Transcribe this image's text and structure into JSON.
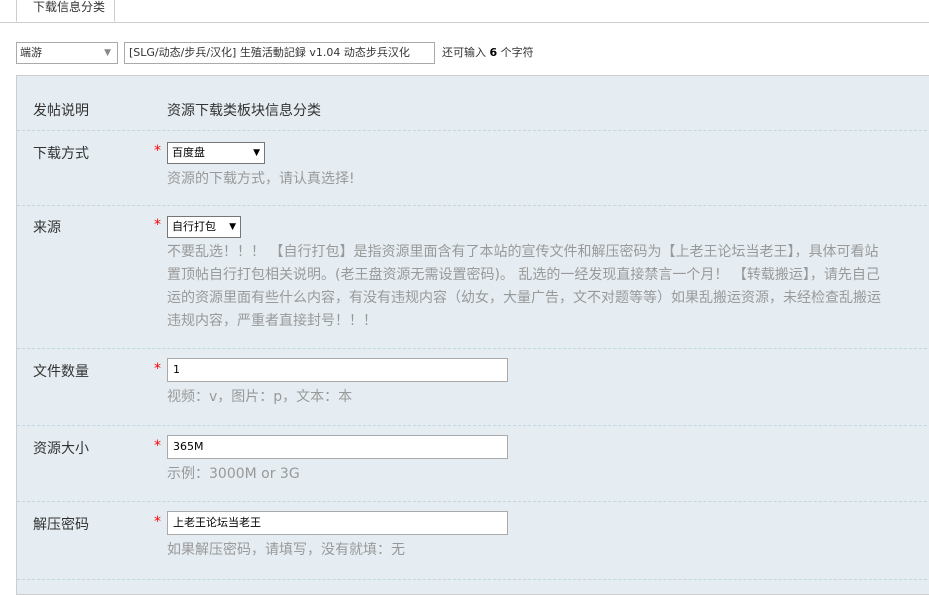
{
  "tab": {
    "label": "下载信息分类"
  },
  "title_row": {
    "type_select": "端游",
    "title_value": "[SLG/动态/步兵/汉化] 生殖活動記録 v1.04 动态步兵汉化",
    "remaining_prefix": "还可输入",
    "remaining_count": "6",
    "remaining_suffix": "个字符"
  },
  "form": {
    "intro": {
      "label": "发帖说明",
      "value": "资源下载类板块信息分类"
    },
    "download_method": {
      "label": "下载方式",
      "required": "*",
      "selected": "百度盘",
      "hint": "资源的下载方式，请认真选择!"
    },
    "source": {
      "label": "来源",
      "required": "*",
      "selected": "自行打包",
      "hint_lines": [
        "不要乱选！！！ 【自行打包】是指资源里面含有了本站的宣传文件和解压密码为【上老王论坛当老王】，具体可看站",
        "置顶帖自行打包相关说明。(老王盘资源无需设置密码)。 乱选的一经发现直接禁言一个月！ 【转载搬运】，请先自己",
        "运的资源里面有些什么内容，有没有违规内容（幼女，大量广告，文不对题等等）如果乱搬运资源，未经检查乱搬运",
        "违规内容，严重者直接封号！！！"
      ]
    },
    "file_count": {
      "label": "文件数量",
      "required": "*",
      "value": "1",
      "hint": "视频：v，图片：p，文本：本"
    },
    "size": {
      "label": "资源大小",
      "required": "*",
      "value": "365M",
      "hint": "示例：3000M or 3G"
    },
    "password": {
      "label": "解压密码",
      "required": "*",
      "value": "上老王论坛当老王",
      "hint": "如果解压密码，请填写，没有就填：无"
    }
  },
  "colors": {
    "panel_bg": "#e5edf2",
    "required": "#ff0000",
    "hint": "#999999",
    "border": "#cdcdcd"
  }
}
